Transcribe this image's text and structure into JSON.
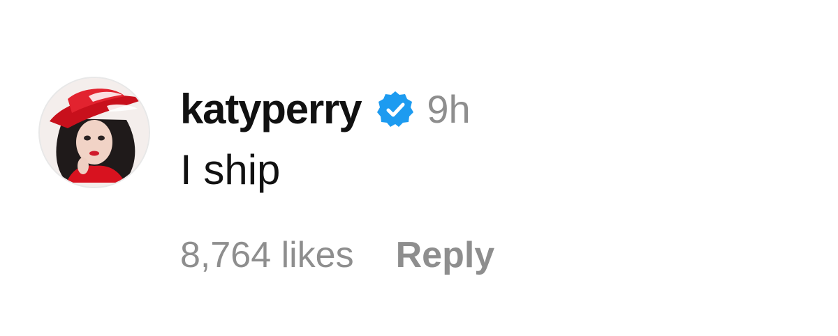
{
  "comment": {
    "username": "katyperry",
    "verified": true,
    "verified_icon": "verified-badge-icon",
    "verified_color": "#1d9bf0",
    "time": "9h",
    "text": "I ship",
    "likes": "8,764 likes",
    "reply_label": "Reply",
    "avatar": "profile-avatar"
  }
}
